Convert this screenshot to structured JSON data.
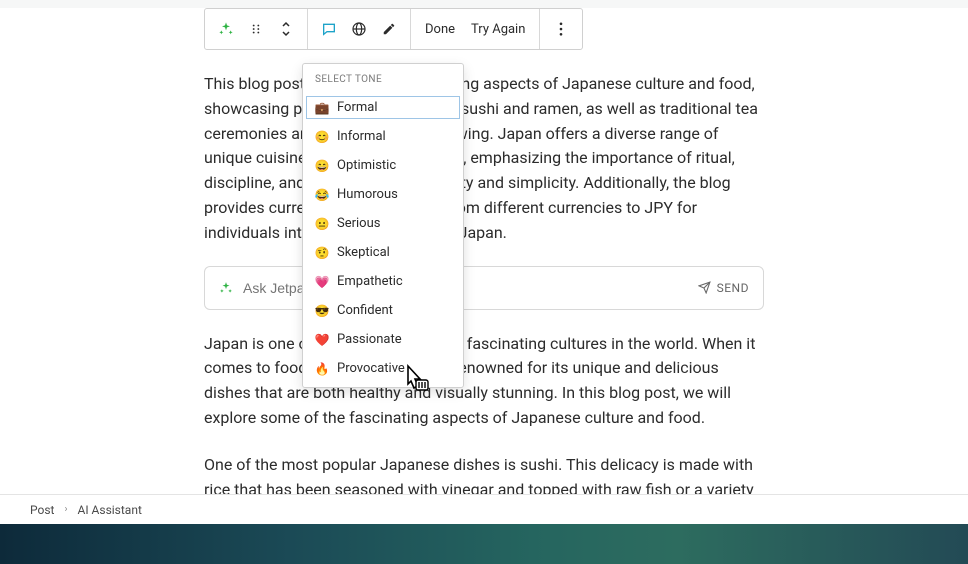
{
  "toolbar": {
    "done_label": "Done",
    "try_again_label": "Try Again"
  },
  "dropdown": {
    "header": "SELECT TONE",
    "items": [
      {
        "emoji": "💼",
        "label": "Formal",
        "selected": true
      },
      {
        "emoji": "😊",
        "label": "Informal"
      },
      {
        "emoji": "😄",
        "label": "Optimistic"
      },
      {
        "emoji": "😂",
        "label": "Humorous"
      },
      {
        "emoji": "😐",
        "label": "Serious"
      },
      {
        "emoji": "🤨",
        "label": "Skeptical"
      },
      {
        "emoji": "💗",
        "label": "Empathetic"
      },
      {
        "emoji": "😎",
        "label": "Confident"
      },
      {
        "emoji": "❤️",
        "label": "Passionate"
      },
      {
        "emoji": "🔥",
        "label": "Provocative"
      }
    ]
  },
  "paragraphs": {
    "p1": "This blog post explores the fascinating aspects of Japanese culture and food, showcasing popular dishes such as sushi and ramen, as well as traditional tea ceremonies and cherry blossom viewing. Japan offers a diverse range of unique cuisine and cultural practices, emphasizing the importance of ritual, discipline, and appreciation for beauty and simplicity. Additionally, the blog provides currency exchange rates from different currencies to JPY for individuals interested in traveling to Japan.",
    "p2": "Japan is one of the most unique and fascinating cultures in the world. When it comes to food, Japan is especially renowned for its unique and delicious dishes that are both healthy and visually stunning. In this blog post, we will explore some of the fascinating aspects of Japanese culture and food.",
    "p3": "One of the most popular Japanese dishes is sushi. This delicacy is made with rice that has been seasoned with vinegar and topped with raw fish or a variety of other ingredients. Sushi is known for its unique flavors and textures, and it represents an"
  },
  "ask": {
    "placeholder": "Ask Jetpack AI",
    "send_label": "SEND"
  },
  "breadcrumb": {
    "root": "Post",
    "current": "AI Assistant"
  }
}
